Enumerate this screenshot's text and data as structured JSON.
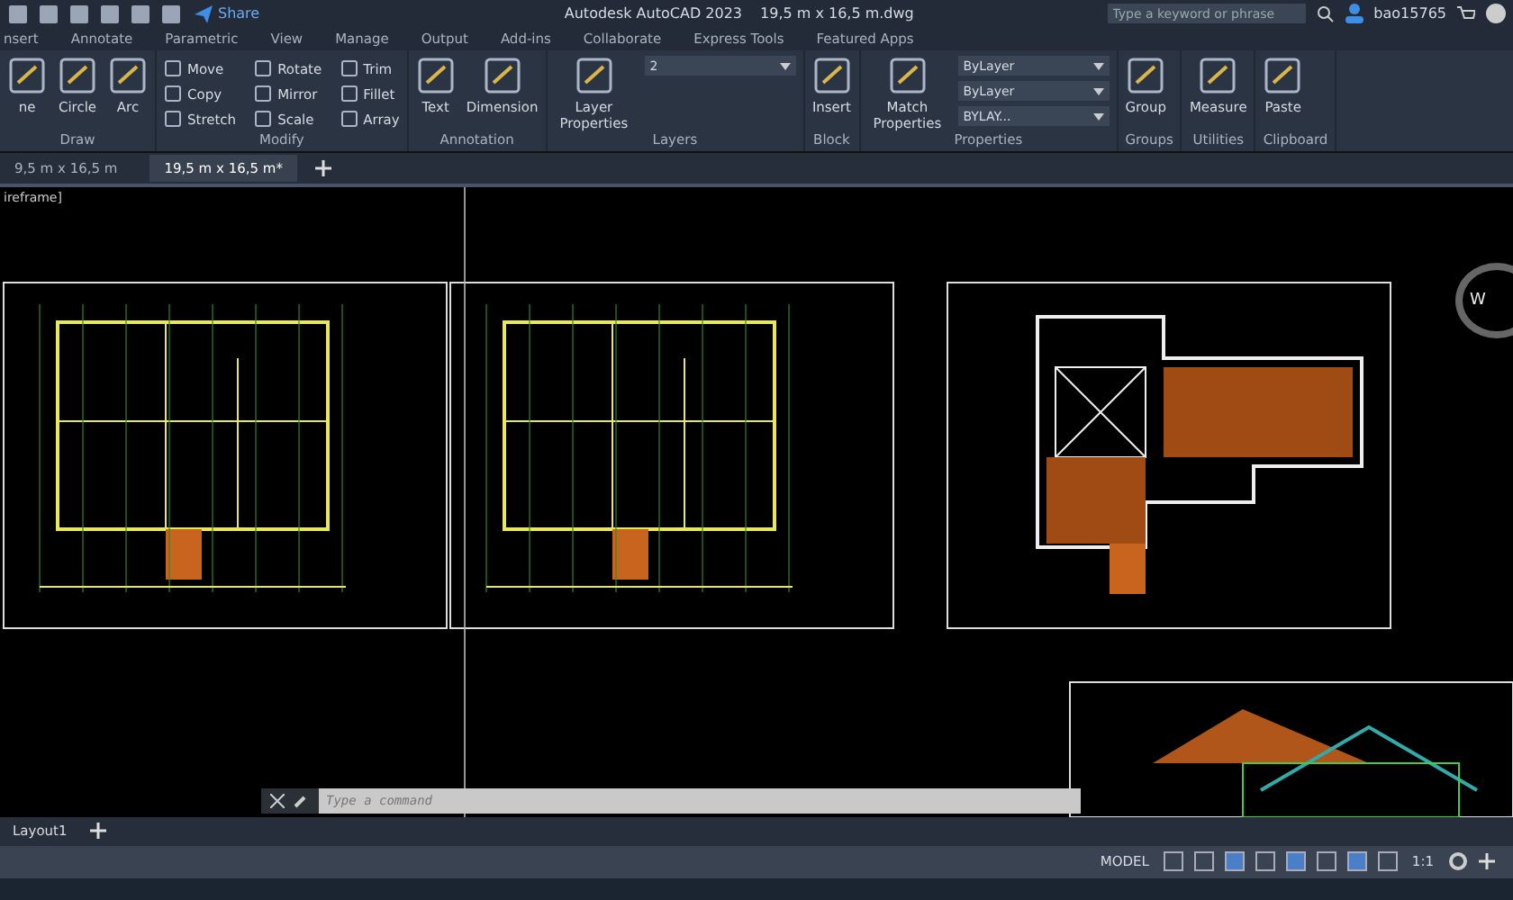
{
  "title_bar": {
    "share": "Share",
    "title": "Autodesk AutoCAD 2023",
    "file": "19,5 m x 16,5 m.dwg",
    "search": {
      "placeholder": "Type a keyword or phrase"
    },
    "user": "bao15765"
  },
  "ribbon_tabs": [
    {
      "label": "nsert",
      "selected": false
    },
    {
      "label": "Annotate",
      "selected": false
    },
    {
      "label": "Parametric",
      "selected": false
    },
    {
      "label": "View",
      "selected": false
    },
    {
      "label": "Manage",
      "selected": false
    },
    {
      "label": "Output",
      "selected": false
    },
    {
      "label": "Add-ins",
      "selected": false
    },
    {
      "label": "Collaborate",
      "selected": false
    },
    {
      "label": "Express Tools",
      "selected": false
    },
    {
      "label": "Featured Apps",
      "selected": false
    }
  ],
  "panels": [
    {
      "title": "Draw",
      "large": [
        "ne",
        "Circle",
        "Arc"
      ]
    },
    {
      "title": "Modify",
      "small": [
        "Move",
        "Copy",
        "Stretch",
        "Rotate",
        "Mirror",
        "Scale",
        "Trim",
        "Fillet",
        "Array"
      ]
    },
    {
      "title": "Annotation",
      "large": [
        "Text",
        "Dimension"
      ]
    },
    {
      "title": "Layers",
      "large": [
        "Layer Properties"
      ],
      "combos": [
        "2"
      ]
    },
    {
      "title": "Block",
      "large": [
        "Insert"
      ]
    },
    {
      "title": "Properties",
      "large": [
        "Match Properties"
      ],
      "combos": [
        "ByLayer",
        "ByLayer",
        "BYLAY..."
      ]
    },
    {
      "title": "Groups",
      "large": [
        "Group"
      ]
    },
    {
      "title": "Utilities",
      "large": [
        "Measure"
      ]
    },
    {
      "title": "Clipboard",
      "large": [
        "Paste"
      ]
    }
  ],
  "doc_tabs": [
    {
      "label": "9,5 m x 16,5 m",
      "selected": false
    },
    {
      "label": "19,5 m x 16,5 m*",
      "selected": true
    }
  ],
  "viewport_label": "ireframe]",
  "viewcube": "W",
  "command_line": {
    "placeholder": "Type a command"
  },
  "layout_tabs": [
    {
      "label": "Layout1",
      "selected": false
    }
  ],
  "status_bar": {
    "mode": "MODEL",
    "scale": "1:1"
  }
}
